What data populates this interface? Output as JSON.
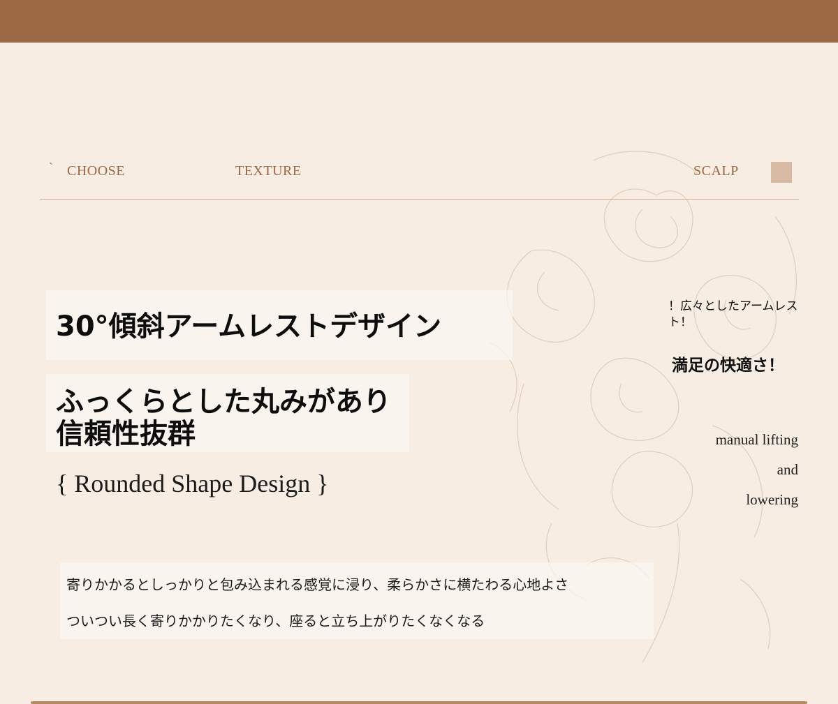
{
  "colors": {
    "top_bar": "#9c6844",
    "background": "#f7ede3",
    "nav_text": "#9c6844",
    "nav_square": "#d7b9a4",
    "divider": "#cfae98"
  },
  "nav": {
    "tick": "`",
    "items": [
      "CHOOSE",
      "TEXTURE",
      "SCALP"
    ],
    "square_icon": "square-icon"
  },
  "headline": {
    "line1": "30°傾斜アームレストデザイン",
    "line2a": "ふっくらとした丸みがあり",
    "line2b": "信頼性抜群"
  },
  "subtitle_en": "{ Rounded Shape Design }",
  "body": {
    "line1": "寄りかかるとしっかりと包み込まれる感覚に浸り、柔らかさに横たわる心地よさ",
    "line2": "ついつい長く寄りかかりたくなり、座ると立ち上がりたくなくなる"
  },
  "side": {
    "note": "！広々としたアームレスト！",
    "strong": "満足の快適さ！",
    "en_lines": [
      "manual lifting",
      "and",
      "lowering"
    ]
  },
  "decoration": {
    "background_art": "rose-line-art"
  }
}
